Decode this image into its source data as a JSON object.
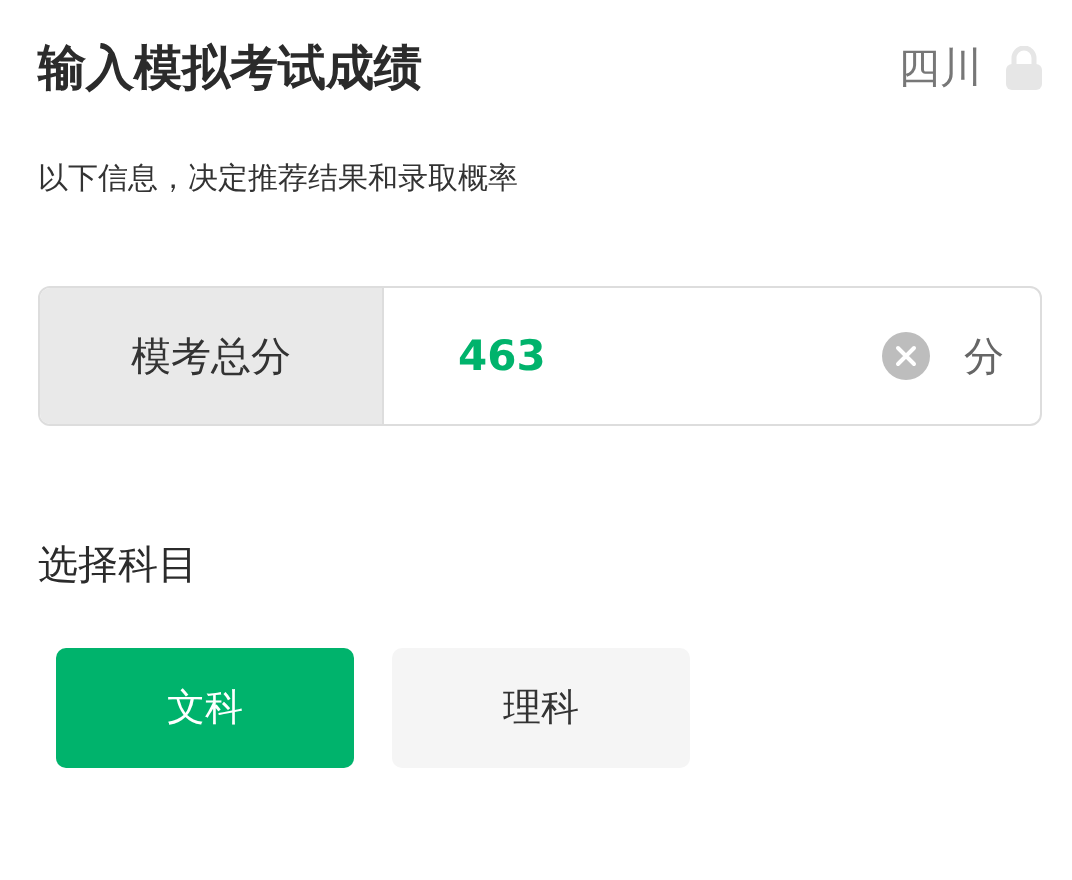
{
  "header": {
    "title": "输入模拟考试成绩",
    "region": "四川"
  },
  "subtitle": "以下信息，决定推荐结果和录取概率",
  "score": {
    "label": "模考总分",
    "value": "463",
    "unit": "分"
  },
  "subject": {
    "title": "选择科目",
    "options": [
      {
        "label": "文科",
        "selected": true
      },
      {
        "label": "理科",
        "selected": false
      }
    ]
  }
}
